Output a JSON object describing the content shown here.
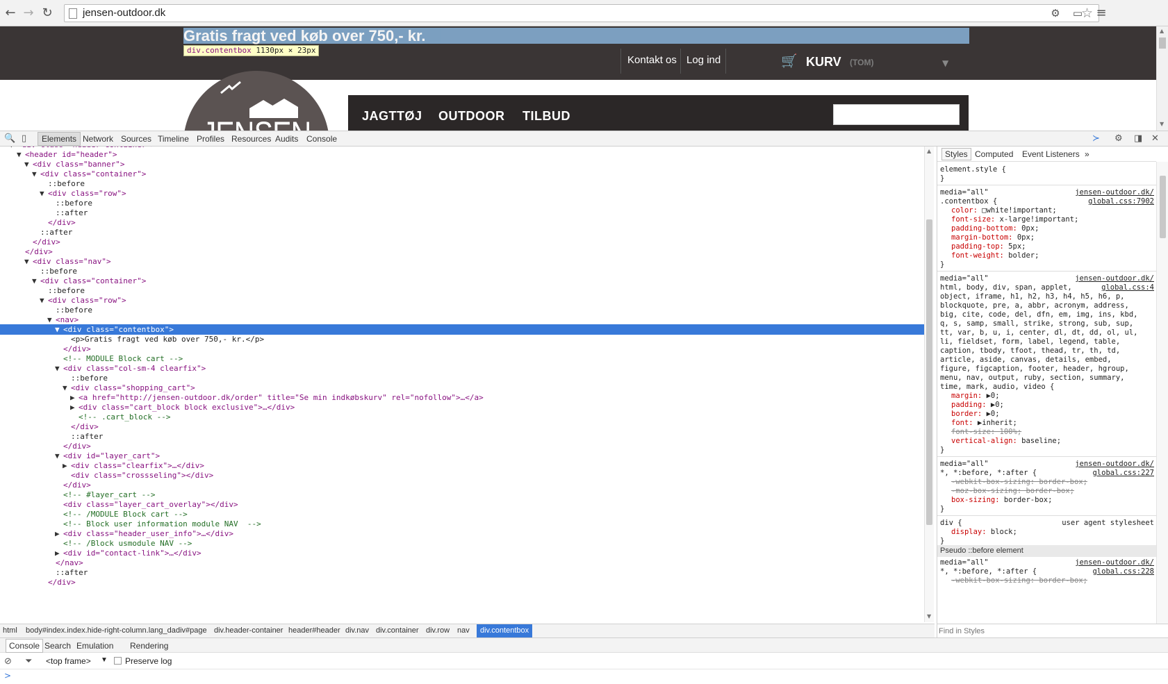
{
  "browser": {
    "back_icon": "←",
    "forward_icon": "→",
    "reload_icon": "↻",
    "url": "jensen-outdoor.dk",
    "bookmark_icon": "☆",
    "menu_icon": "≡"
  },
  "site": {
    "banner_text": "Gratis fragt ved køb over 750,- kr.",
    "tooltip_tag": "div.contentbox",
    "tooltip_size": "1130px × 23px",
    "contact_link": "Kontakt os",
    "login_link": "Log ind",
    "cart_label": "KURV",
    "cart_state": "(TOM)",
    "logo_text": "JENSEN",
    "nav": [
      "JAGTTØJ",
      "OUTDOOR",
      "TILBUD"
    ]
  },
  "devtools": {
    "tabs": [
      "Elements",
      "Network",
      "Sources",
      "Timeline",
      "Profiles",
      "Resources",
      "Audits",
      "Console"
    ],
    "elements_tree": [
      "<div class=\"header-container\">",
      "<header id=\"header\">",
      "<div class=\"banner\">",
      "<div class=\"container\">",
      "::before",
      "<div class=\"row\">",
      "::before",
      "::after",
      "</div>",
      "::after",
      "</div>",
      "</div>",
      "<div class=\"nav\">",
      "::before",
      "<div class=\"container\">",
      "::before",
      "<div class=\"row\">",
      "::before",
      "<nav>",
      "<div class=\"contentbox\">",
      "<p>Gratis fragt ved køb over 750,- kr.</p>",
      "</div>",
      "<!-- MODULE Block cart -->",
      "<div class=\"col-sm-4 clearfix\">",
      "::before",
      "<div class=\"shopping_cart\">",
      "<a href=\"http://jensen-outdoor.dk/order\" title=\"Se min indkøbskurv\" rel=\"nofollow\">…</a>",
      "<div class=\"cart_block block exclusive\">…</div>",
      "<!-- .cart_block -->",
      "</div>",
      "::after",
      "</div>",
      "<div id=\"layer_cart\">",
      "<div class=\"clearfix\">…</div>",
      "<div class=\"crossseling\"></div>",
      "</div>",
      "<!-- #layer_cart -->",
      "<div class=\"layer_cart_overlay\"></div>",
      "<!-- /MODULE Block cart -->",
      "<!-- Block user information module NAV  -->",
      "<div class=\"header_user_info\">…</div>",
      "<!-- /Block usmodule NAV -->",
      "<div id=\"contact-link\">…</div>",
      "</nav>",
      "::after",
      "</div>"
    ],
    "breadcrumbs": [
      "html",
      "body#index.index.hide-right-column.lang_da",
      "div#page",
      "div.header-container",
      "header#header",
      "div.nav",
      "div.container",
      "div.row",
      "nav",
      "div.contentbox"
    ],
    "styles_tabs": [
      "Styles",
      "Computed",
      "Event Listeners",
      "»"
    ],
    "styles_rows": [
      "element.style {",
      "}",
      "media=\"all\"",
      ".contentbox {",
      "color: □white!important;",
      "font-size: x-large!important;",
      "padding-bottom: 0px;",
      "margin-bottom: 0px;",
      "padding-top: 5px;",
      "font-weight: bolder;",
      "}",
      "media=\"all\"",
      "html, body, div, span, applet,",
      "object, iframe, h1, h2, h3, h4, h5, h6, p,",
      "blockquote, pre, a, abbr, acronym, address,",
      "big, cite, code, del, dfn, em, img, ins, kbd,",
      "q, s, samp, small, strike, strong, sub, sup,",
      "tt, var, b, u, i, center, dl, dt, dd, ol, ul,",
      "li, fieldset, form, label, legend, table,",
      "caption, tbody, tfoot, thead, tr, th, td,",
      "article, aside, canvas, details, embed,",
      "figure, figcaption, footer, header, hgroup,",
      "menu, nav, output, ruby, section, summary,",
      "time, mark, audio, video {",
      "margin: ▶0;",
      "padding: ▶0;",
      "border: ▶0;",
      "font: ▶inherit;",
      "font-size: 100%;",
      "vertical-align: baseline;",
      "}",
      "media=\"all\"",
      "*, *:before, *:after {",
      "-webkit-box-sizing: border-box;",
      "-moz-box-sizing: border-box;",
      "box-sizing: border-box;",
      "}",
      "div {",
      "display: block;",
      "}",
      "Pseudo ::before element",
      "media=\"all\"",
      "*, *:before, *:after {",
      "-webkit-box-sizing: border-box;"
    ],
    "styles_sources": [
      "jensen-outdoor.dk/",
      "global.css:7902",
      "jensen-outdoor.dk/",
      "global.css:4",
      "jensen-outdoor.dk/",
      "global.css:227",
      "user agent stylesheet",
      "jensen-outdoor.dk/",
      "global.css:228"
    ],
    "find_placeholder": "Find in Styles",
    "drawer_tabs": [
      "Console",
      "Search",
      "Emulation",
      "Rendering"
    ],
    "frame_select": "<top frame>",
    "preserve_log": "Preserve log",
    "console_prompt": ">"
  }
}
